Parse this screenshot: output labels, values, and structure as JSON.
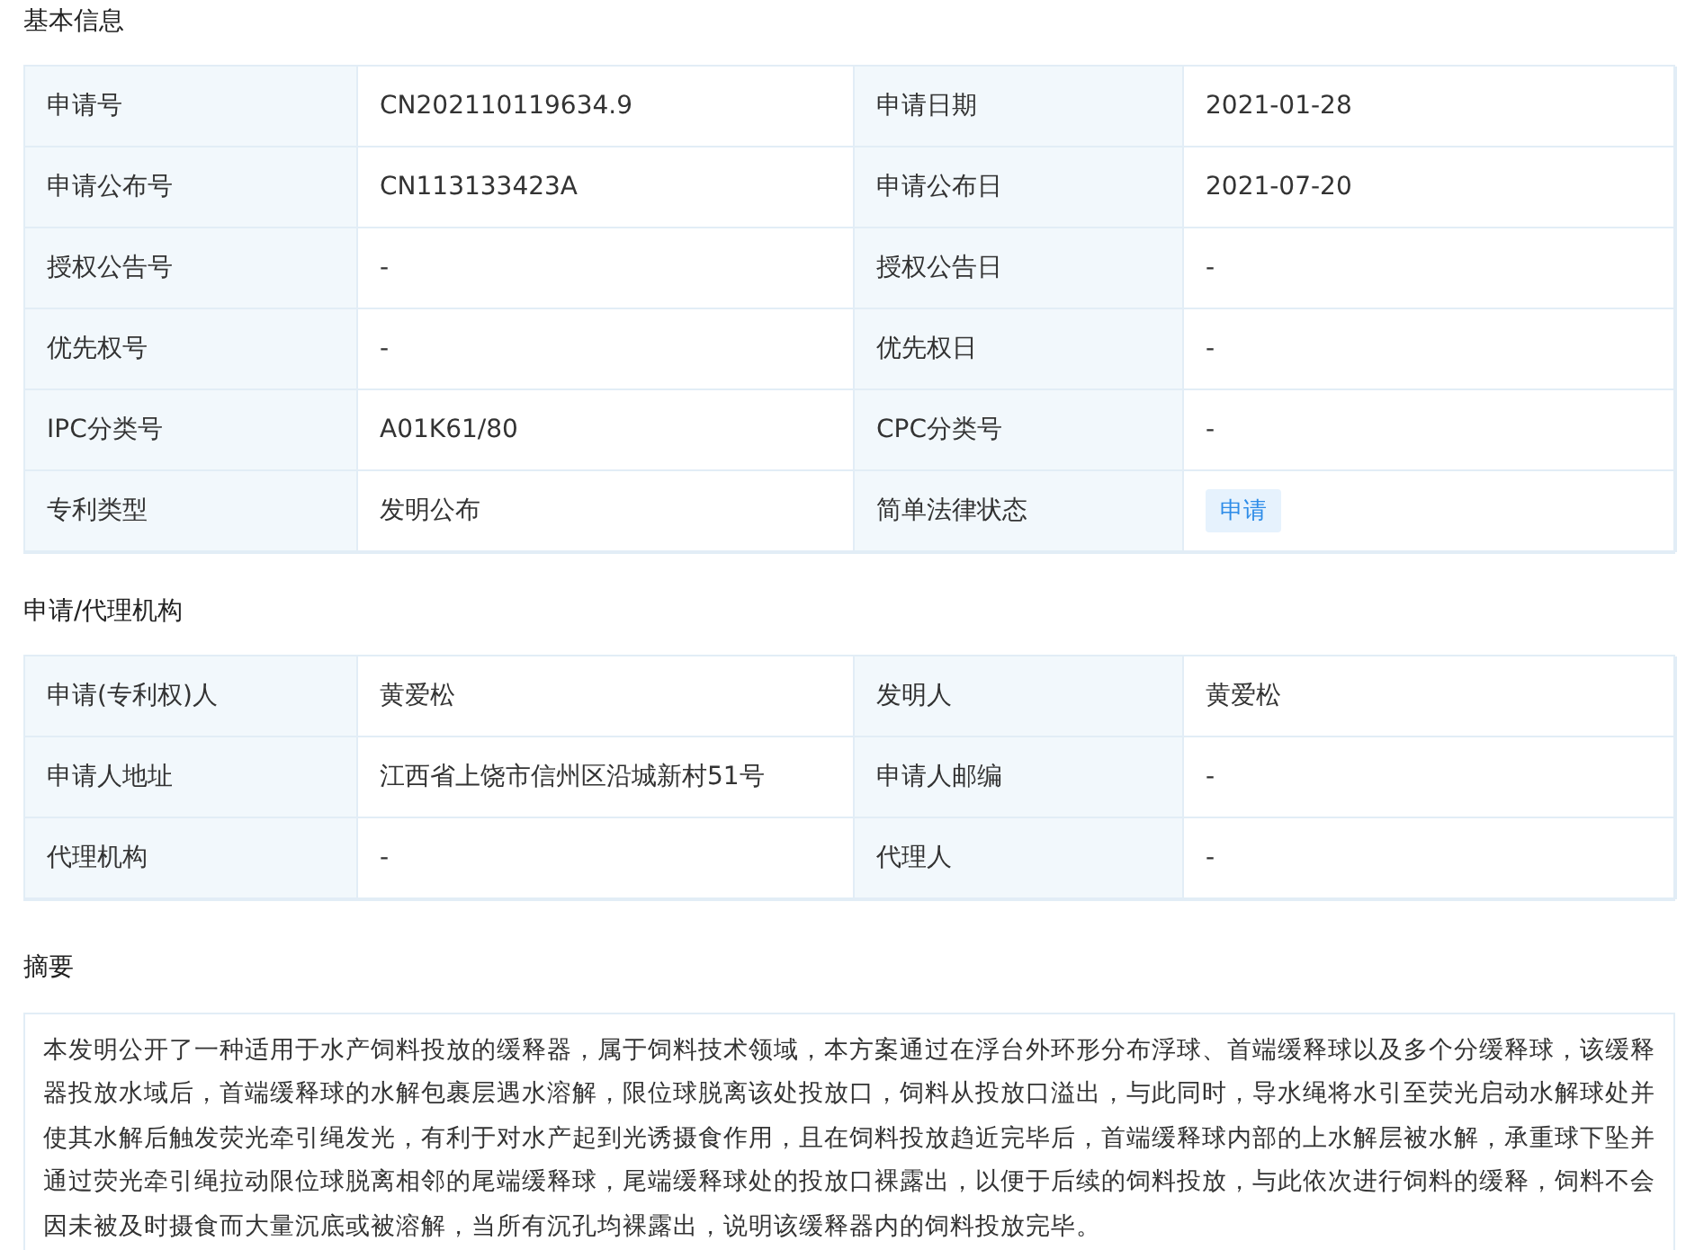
{
  "sections": [
    {
      "title": "基本信息",
      "rows": [
        [
          {
            "label": "申请号",
            "value": "CN202110119634.9",
            "kind": "text"
          },
          {
            "label": "申请日期",
            "value": "2021-01-28",
            "kind": "text"
          }
        ],
        [
          {
            "label": "申请公布号",
            "value": "CN113133423A",
            "kind": "text"
          },
          {
            "label": "申请公布日",
            "value": "2021-07-20",
            "kind": "text"
          }
        ],
        [
          {
            "label": "授权公告号",
            "value": "-",
            "kind": "text"
          },
          {
            "label": "授权公告日",
            "value": "-",
            "kind": "text"
          }
        ],
        [
          {
            "label": "优先权号",
            "value": "-",
            "kind": "text"
          },
          {
            "label": "优先权日",
            "value": "-",
            "kind": "text"
          }
        ],
        [
          {
            "label": "IPC分类号",
            "value": "A01K61/80",
            "kind": "text"
          },
          {
            "label": "CPC分类号",
            "value": "-",
            "kind": "text"
          }
        ],
        [
          {
            "label": "专利类型",
            "value": "发明公布",
            "kind": "text"
          },
          {
            "label": "简单法律状态",
            "value": "申请",
            "kind": "tag"
          }
        ]
      ]
    },
    {
      "title": "申请/代理机构",
      "rows": [
        [
          {
            "label": "申请(专利权)人",
            "value": "黄爱松",
            "kind": "text"
          },
          {
            "label": "发明人",
            "value": "黄爱松",
            "kind": "text"
          }
        ],
        [
          {
            "label": "申请人地址",
            "value": "江西省上饶市信州区沿城新村51号",
            "kind": "text"
          },
          {
            "label": "申请人邮编",
            "value": "-",
            "kind": "text"
          }
        ],
        [
          {
            "label": "代理机构",
            "value": "-",
            "kind": "text"
          },
          {
            "label": "代理人",
            "value": "-",
            "kind": "text"
          }
        ]
      ]
    }
  ],
  "abstract": {
    "title": "摘要",
    "text": "本发明公开了一种适用于水产饲料投放的缓释器，属于饲料技术领域，本方案通过在浮台外环形分布浮球、首端缓释球以及多个分缓释球，该缓释器投放水域后，首端缓释球的水解包裹层遇水溶解，限位球脱离该处投放口，饲料从投放口溢出，与此同时，导水绳将水引至荧光启动水解球处并使其水解后触发荧光牵引绳发光，有利于对水产起到光诱摄食作用，且在饲料投放趋近完毕后，首端缓释球内部的上水解层被水解，承重球下坠并通过荧光牵引绳拉动限位球脱离相邻的尾端缓释球，尾端缓释球处的投放口裸露出，以便于后续的饲料投放，与此依次进行饲料的缓释，饲料不会因未被及时摄食而大量沉底或被溶解，当所有沉孔均裸露出，说明该缓释器内的饲料投放完毕。"
  }
}
